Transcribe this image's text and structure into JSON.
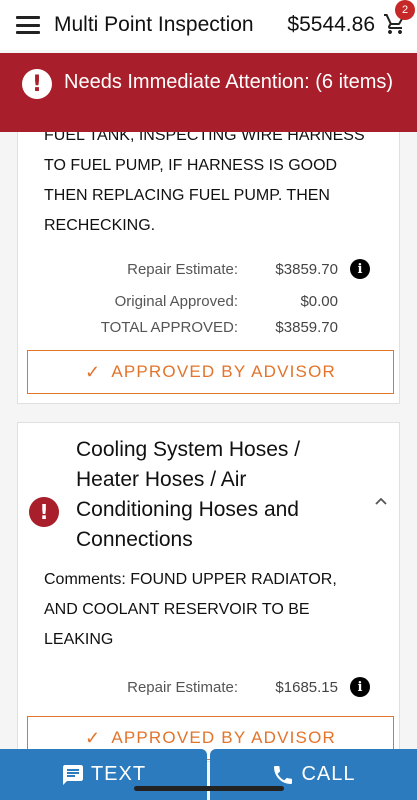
{
  "header": {
    "title": "Multi Point Inspection",
    "total": "$5544.86",
    "cart_count": "2"
  },
  "banner": {
    "text": "Needs Immediate Attention: (6 items)",
    "icon": "!"
  },
  "items": [
    {
      "comment": "FUEL TANK, INSPECTING WIRE HARNESS TO FUEL PUMP, IF HARNESS IS GOOD THEN REPLACING FUEL PUMP. THEN RECHECKING.",
      "repair_label": "Repair Estimate:",
      "repair_value": "$3859.70",
      "orig_label": "Original Approved:",
      "orig_value": "$0.00",
      "total_label": "TOTAL APPROVED:",
      "total_value": "$3859.70",
      "status_label": "APPROVED BY ADVISOR"
    },
    {
      "title": "Cooling System Hoses / Heater Hoses / Air Conditioning Hoses and Connections",
      "comment": "Comments: FOUND UPPER RADIATOR, AND COOLANT RESERVOIR TO BE LEAKING",
      "repair_label": "Repair Estimate:",
      "repair_value": "$1685.15",
      "status_label": "APPROVED BY ADVISOR"
    }
  ],
  "footer": {
    "text_label": "TEXT",
    "call_label": "CALL"
  },
  "icons": {
    "info": "i",
    "check": "✓"
  },
  "colors": {
    "alert_red": "#a81e2a",
    "approved_orange": "#e2742c",
    "action_blue": "#2c7bbe"
  }
}
